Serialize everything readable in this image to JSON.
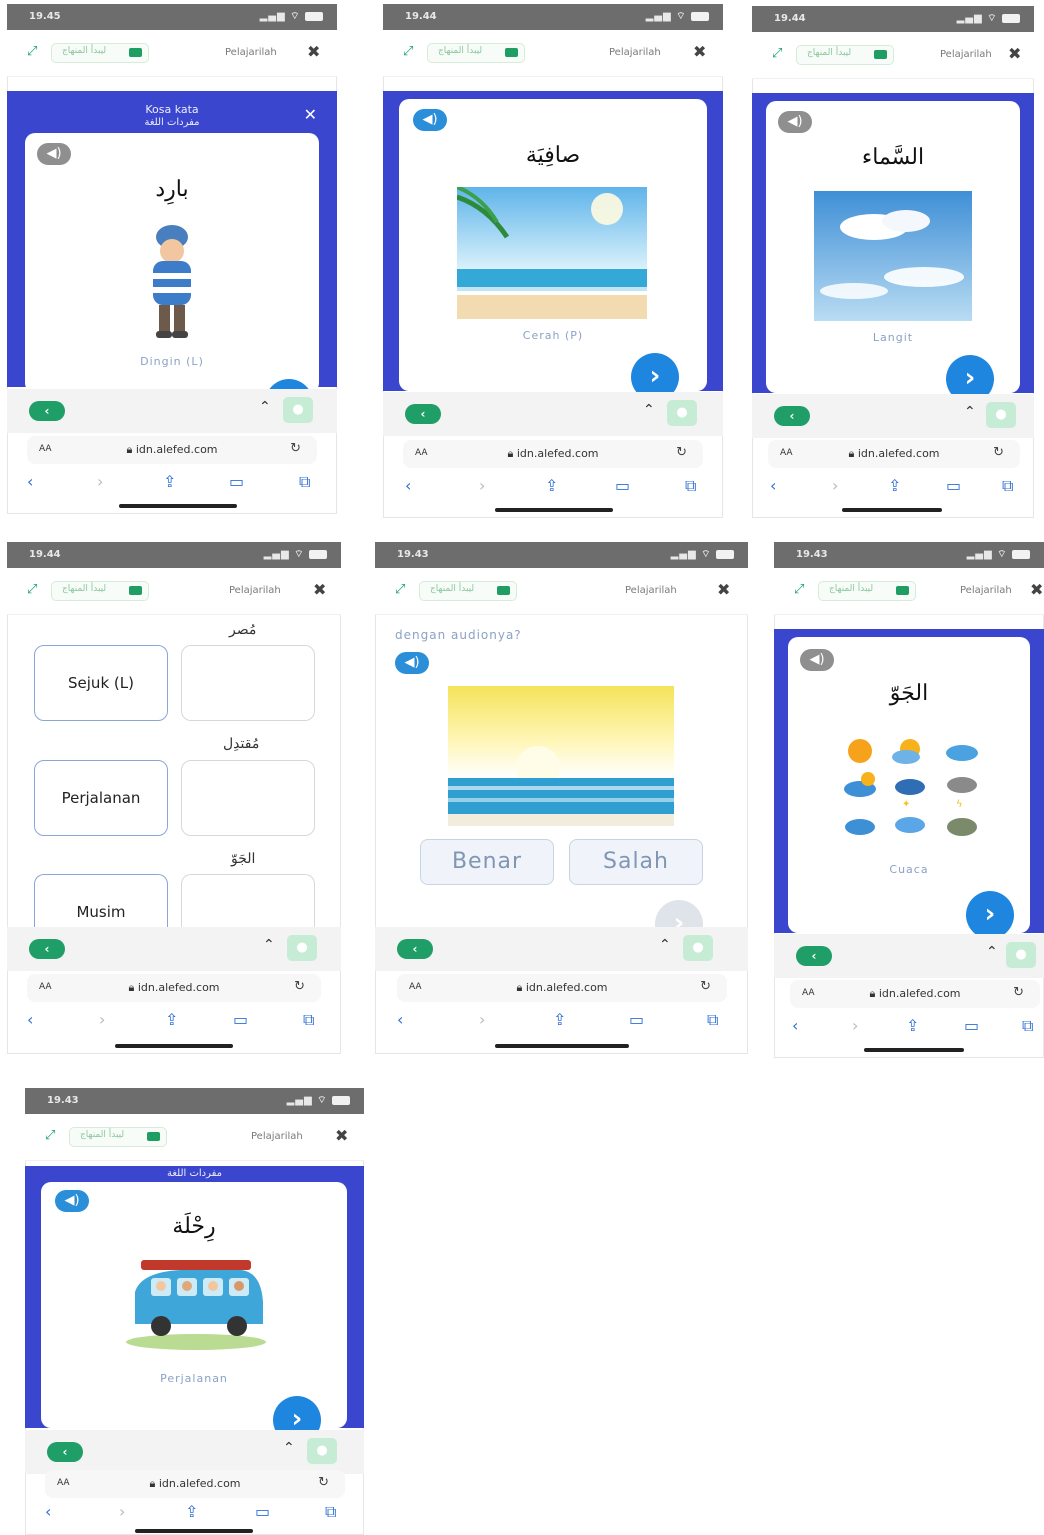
{
  "common": {
    "pill_text": "ليبدأ المنهاج",
    "lesson_label": "Pelajarilah",
    "url": "idn.alefed.com",
    "aa": "AA"
  },
  "screens": {
    "s1": {
      "time": "19.45",
      "title_id": "Kosa kata",
      "title_ar": "مفردات اللغة",
      "arabic": "بارِد",
      "caption": "Dingin (L)"
    },
    "s2": {
      "time": "19.44",
      "arabic": "صافِيَة",
      "caption": "Cerah (P)"
    },
    "s3": {
      "time": "19.44",
      "arabic": "السَّماء",
      "caption": "Langit"
    },
    "s4": {
      "time": "19.44",
      "pairs": [
        {
          "ar": "مُصر",
          "word": "Sejuk (L)"
        },
        {
          "ar": "مُقتدِل",
          "word": "Perjalanan"
        },
        {
          "ar": "الجَوّ",
          "word": "Musim"
        }
      ]
    },
    "s5": {
      "time": "19.43",
      "question": "dengan audionya?",
      "true_label": "Benar",
      "false_label": "Salah"
    },
    "s6": {
      "time": "19.43",
      "arabic": "الجَوّ",
      "caption": "Cuaca"
    },
    "s7": {
      "time": "19.43",
      "title_ar": "مفردات اللغة",
      "arabic": "رِحْلَة",
      "caption": "Perjalanan"
    }
  }
}
